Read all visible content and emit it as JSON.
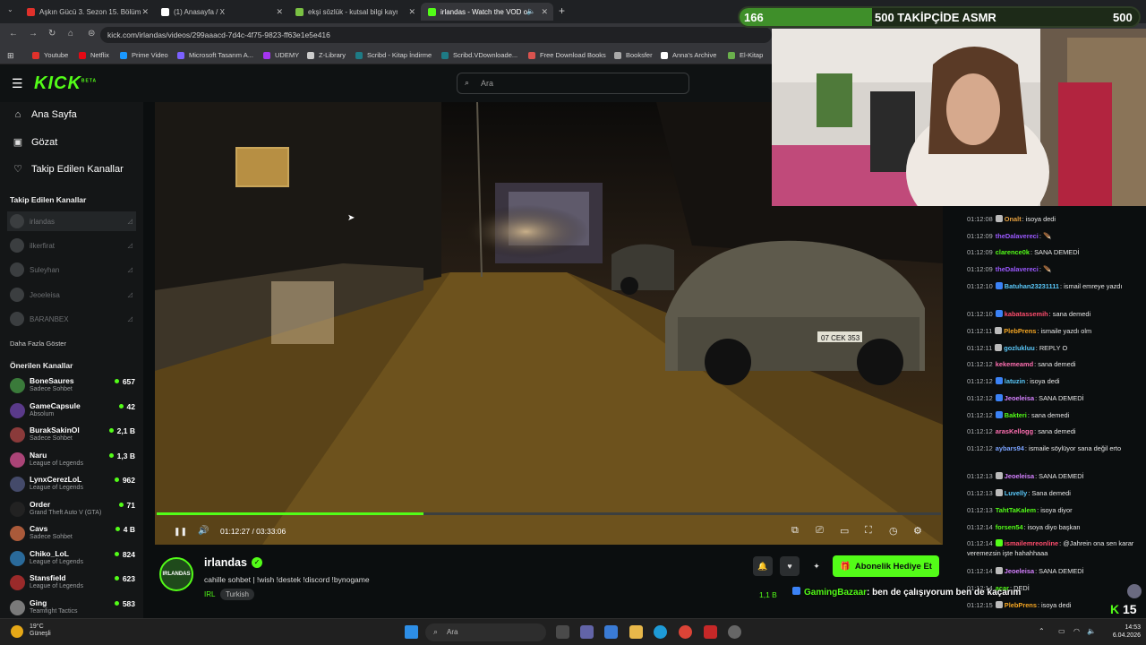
{
  "browser": {
    "tabs": [
      {
        "label": "Aşkın Gücü 3. Sezon 15. Bölüm",
        "color": "#e0312b"
      },
      {
        "label": "(1) Anasayfa / X",
        "color": "#ffffff"
      },
      {
        "label": "ekşi sözlük - kutsal bilgi kaynağı",
        "color": "#7ac143"
      },
      {
        "label": "irlandas - Watch the VOD o",
        "color": "#53fc18"
      }
    ],
    "new_tab": "+",
    "url": "kick.com/irlandas/videos/299aaacd-7d4c-4f75-9823-ff63e1e5e416",
    "bookmarks": [
      {
        "label": "Youtube",
        "color": "#e0312b"
      },
      {
        "label": "Netflix",
        "color": "#e50914"
      },
      {
        "label": "Prime Video",
        "color": "#1a98ff"
      },
      {
        "label": "Microsoft Tasarım A...",
        "color": "#7b61ff"
      },
      {
        "label": "UDEMY",
        "color": "#a435f0"
      },
      {
        "label": "Z-Library",
        "color": "#cccccc"
      },
      {
        "label": "Scribd - Kitap İndirme",
        "color": "#1e7b85"
      },
      {
        "label": "Scribd.VDownloade...",
        "color": "#1e7b85"
      },
      {
        "label": "Free Download Books",
        "color": "#d9534f"
      },
      {
        "label": "Booksfer",
        "color": "#aaaaaa"
      },
      {
        "label": "Anna's Archive",
        "color": "#ffffff"
      },
      {
        "label": "El-Kitap",
        "color": "#6ab04c"
      }
    ]
  },
  "kick": {
    "logo": "KICK",
    "logo_sup": "BETA",
    "search_placeholder": "Ara",
    "nav": [
      {
        "label": "Ana Sayfa",
        "icon": "home-icon",
        "glyph": "⌂"
      },
      {
        "label": "Gözat",
        "icon": "browse-icon",
        "glyph": "▣"
      },
      {
        "label": "Takip Edilen Kanallar",
        "icon": "heart-icon",
        "glyph": "♡"
      }
    ],
    "followed_title": "Takip Edilen Kanallar",
    "followed": [
      "irlandas",
      "ilkerfirat",
      "Suleyhan",
      "Jeoeleisa",
      "BARANBEX"
    ],
    "show_more": "Daha Fazla Göster",
    "recommended_title": "Önerilen Kanallar",
    "recommended": [
      {
        "name": "BoneSaures",
        "category": "Sadece Sohbet",
        "viewers": "657",
        "color": "#3a7a3a"
      },
      {
        "name": "GameCapsule",
        "category": "Absolum",
        "viewers": "42",
        "color": "#5a3a8a"
      },
      {
        "name": "BurakSakinOl",
        "category": "Sadece Sohbet",
        "viewers": "2,1 B",
        "color": "#8a3a3a"
      },
      {
        "name": "Naru",
        "category": "League of Legends",
        "viewers": "1,3 B",
        "color": "#aa4477"
      },
      {
        "name": "LynxCerezLoL",
        "category": "League of Legends",
        "viewers": "962",
        "color": "#444a6a"
      },
      {
        "name": "Order",
        "category": "Grand Theft Auto V (GTA)",
        "viewers": "71",
        "color": "#222222"
      },
      {
        "name": "Cavs",
        "category": "Sadece Sohbet",
        "viewers": "4 B",
        "color": "#aa5a3a"
      },
      {
        "name": "Chiko_LoL",
        "category": "League of Legends",
        "viewers": "824",
        "color": "#2a6a9a"
      },
      {
        "name": "Stansfield",
        "category": "League of Legends",
        "viewers": "623",
        "color": "#9a2a2a"
      },
      {
        "name": "Ging",
        "category": "Teamfight Tactics",
        "viewers": "583",
        "color": "#7a7a7a"
      }
    ]
  },
  "player": {
    "time": "01:12:27 / 03:33:06",
    "progress": 0.34,
    "pause_glyph": "❚❚",
    "volume_glyph": "🔊",
    "controls": [
      {
        "name": "picture-in-picture-icon",
        "glyph": "⧉"
      },
      {
        "name": "clip-icon",
        "glyph": "⎚"
      },
      {
        "name": "theater-mode-icon",
        "glyph": "▭"
      },
      {
        "name": "fullscreen-icon",
        "glyph": "⛶"
      },
      {
        "name": "speed-icon",
        "glyph": "◷"
      },
      {
        "name": "settings-icon",
        "glyph": "⚙"
      }
    ],
    "plate": "07 CEK 353"
  },
  "channel": {
    "avatar_text": "IRLANDAS",
    "name": "irlandas",
    "title": "cahille sohbet | !wish !destek !discord !bynogame",
    "category": "IRL",
    "language": "Turkish",
    "gift_button": "Abonelik Hediye Et",
    "viewers": "1,1 B",
    "overlay_user": "GamingBazaar",
    "overlay_text": ": ben de çalışıyorum ben de kaçarım"
  },
  "goal": {
    "current": "166",
    "label": "500 TAKİPÇİDE ASMR",
    "target": "500",
    "progress": 0.332
  },
  "chat": [
    {
      "time": "01:12:08",
      "user": "Onalt",
      "color": "#e5a040",
      "badge": "#bbbbbb",
      "text": ": isoya dedi"
    },
    {
      "time": "01:12:09",
      "user": "theDalavereci",
      "color": "#9b59ff",
      "badge": "",
      "text": ": 🪶"
    },
    {
      "time": "01:12:09",
      "user": "clarence0k",
      "color": "#53fc18",
      "badge": "",
      "text": ": SANA DEMEDİ"
    },
    {
      "time": "01:12:09",
      "user": "theDalavereci",
      "color": "#9b59ff",
      "badge": "",
      "text": ": 🪶"
    },
    {
      "time": "01:12:10",
      "user": "Batuhan23231111",
      "color": "#5ac8fa",
      "badge": "#3b82f6",
      "text": ": ismail emreye yazdı"
    },
    {
      "time": "01:12:10",
      "user": "kabatassemih",
      "color": "#ff4d6d",
      "badge": "#3b82f6",
      "text": ": sana demedi"
    },
    {
      "time": "01:12:11",
      "user": "PlebPrens",
      "color": "#f5a623",
      "badge": "#bbbbbb",
      "text": ": ismaile yazdı olm"
    },
    {
      "time": "01:12:11",
      "user": "gozlukluu",
      "color": "#5ac8fa",
      "badge": "#bbbbbb",
      "text": ": REPLY O"
    },
    {
      "time": "01:12:12",
      "user": "kekemeamd",
      "color": "#ff6fb1",
      "badge": "",
      "text": ": sana demedi"
    },
    {
      "time": "01:12:12",
      "user": "latuzin",
      "color": "#5ac8fa",
      "badge": "#3b82f6",
      "text": ": isoya dedi"
    },
    {
      "time": "01:12:12",
      "user": "Jeoeleisa",
      "color": "#d580ff",
      "badge": "#3b82f6",
      "text": ": SANA DEMEDİ"
    },
    {
      "time": "01:12:12",
      "user": "Bakteri",
      "color": "#53fc18",
      "badge": "#3b82f6",
      "text": ": sana demedi"
    },
    {
      "time": "01:12:12",
      "user": "arasKellogg",
      "color": "#ff6fb1",
      "badge": "",
      "text": ": sana demedi"
    },
    {
      "time": "01:12:12",
      "user": "aybars94",
      "color": "#7aa2ff",
      "badge": "",
      "text": ": ismaile söylüyor sana değil erto"
    },
    {
      "time": "01:12:13",
      "user": "Jeoeleisa",
      "color": "#d580ff",
      "badge": "#bbbbbb",
      "text": ": SANA DEMEDİ"
    },
    {
      "time": "01:12:13",
      "user": "Luvelly",
      "color": "#5ac8fa",
      "badge": "#bbbbbb",
      "text": ": Sana demedi"
    },
    {
      "time": "01:12:13",
      "user": "TahtTaKalem",
      "color": "#53fc18",
      "badge": "",
      "text": ": isoya diyor"
    },
    {
      "time": "01:12:14",
      "user": "forsen54",
      "color": "#53fc18",
      "badge": "",
      "text": ": isoya diyo başkan"
    },
    {
      "time": "01:12:14",
      "user": "ismailemreonline",
      "color": "#ff4d6d",
      "badge": "#53fc18",
      "text": ": @Jahrein ona sen karar veremezsin işte hahahhaaa"
    },
    {
      "time": "01:12:14",
      "user": "Jeoeleisa",
      "color": "#d580ff",
      "badge": "#bbbbbb",
      "text": ": SANA DEMEDİ"
    },
    {
      "time": "01:12:14",
      "user": "acar",
      "color": "#53fc18",
      "badge": "",
      "text": ": DEDİ"
    },
    {
      "time": "01:12:15",
      "user": "PlebPrens",
      "color": "#f5a623",
      "badge": "#bbbbbb",
      "text": ": isoya dedi"
    }
  ],
  "kick_badge": {
    "k": "K",
    "count": "15"
  },
  "taskbar": {
    "temp": "19°C",
    "weather": "Güneşli",
    "search": "Ara",
    "time": "14:53",
    "date": "6.04.2026"
  }
}
